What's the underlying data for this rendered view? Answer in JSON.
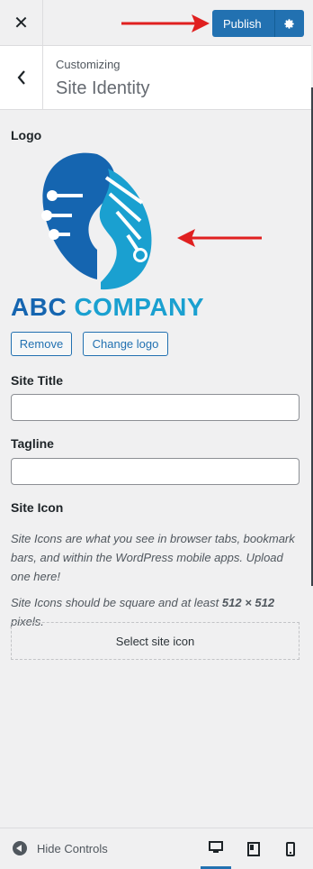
{
  "topbar": {
    "close_icon": "close-icon",
    "publish_label": "Publish",
    "gear_icon": "gear-icon"
  },
  "header": {
    "breadcrumb": "Customizing",
    "title": "Site Identity"
  },
  "logo_section": {
    "label": "Logo",
    "logo_text_part1": "ABC",
    "logo_text_part2": "COMPANY",
    "remove_label": "Remove",
    "change_label": "Change logo"
  },
  "site_title": {
    "label": "Site Title",
    "value": ""
  },
  "tagline": {
    "label": "Tagline",
    "value": ""
  },
  "site_icon": {
    "label": "Site Icon",
    "desc1": "Site Icons are what you see in browser tabs, bookmark bars, and within the WordPress mobile apps. Upload one here!",
    "desc2_pre": "Site Icons should be square and at least ",
    "desc2_dims": "512 × 512",
    "desc2_post": " pixels.",
    "select_label": "Select site icon"
  },
  "footer": {
    "hide_controls_label": "Hide Controls",
    "devices": [
      "desktop-icon",
      "tablet-icon",
      "mobile-icon"
    ]
  },
  "colors": {
    "accent": "#2271b1",
    "logo_dark": "#1565b0",
    "logo_light": "#1aa0d0",
    "annotation_arrow": "#e02020"
  }
}
